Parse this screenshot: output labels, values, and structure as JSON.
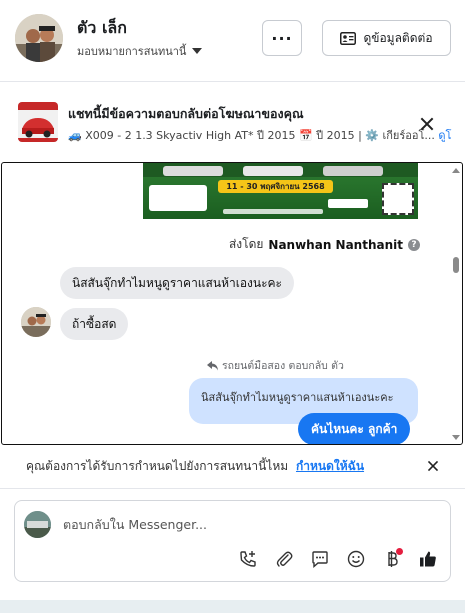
{
  "header": {
    "contact_name": "ตัว เล็ก",
    "assign_label": "มอบหมายการสนทนานี้",
    "more_label": "···",
    "contact_info_label": "ดูข้อมูลติดต่อ"
  },
  "ad": {
    "title": "แชทนี้มีข้อความตอบกลับต่อโฆษณาของคุณ",
    "subtitle_emoji": "🚙",
    "subtitle": "X009 - 2 1.3 Skyactiv High AT* ปี 2015 📅 ปี 2015 | ⚙️ เกียร์ออโ...",
    "see_more": "ดูโ"
  },
  "promo": {
    "date_text": "11 - 30 พฤศจิกายน 2568"
  },
  "conversation": {
    "sent_by_prefix": "ส่งโดย",
    "sent_by_name": "Nanwhan Nanthanit",
    "incoming_1": "นิสสันจุ๊กทำไมหนูดูราคาแสนห้าเองนะคะ",
    "incoming_2": "ถ้าซื้อสด",
    "reply_note": "รถยนต์มือสอง ตอบกลับ ตัว",
    "quoted_text": "นิสสันจุ๊กทำไมหนูดูราคาแสนห้าเองนะคะ",
    "outgoing_1": "คันไหนคะ  ลูกค้า"
  },
  "notice": {
    "text": "คุณต้องการได้รับการกำหนดไปยังการสนทนานี้ไหม",
    "link": "กำหนดให้ฉัน"
  },
  "composer": {
    "placeholder": "ตอบกลับใน Messenger..."
  },
  "icons": {
    "tools": [
      "call-add-icon",
      "attachment-icon",
      "saved-replies-icon",
      "emoji-icon",
      "payment-icon",
      "like-icon"
    ]
  },
  "colors": {
    "accent": "#1877f2",
    "quoted_bg": "#cfe2ff",
    "incoming_bg": "#e9eaed",
    "promo_green": "#2e7d32",
    "badge_red": "#e41e3f"
  }
}
